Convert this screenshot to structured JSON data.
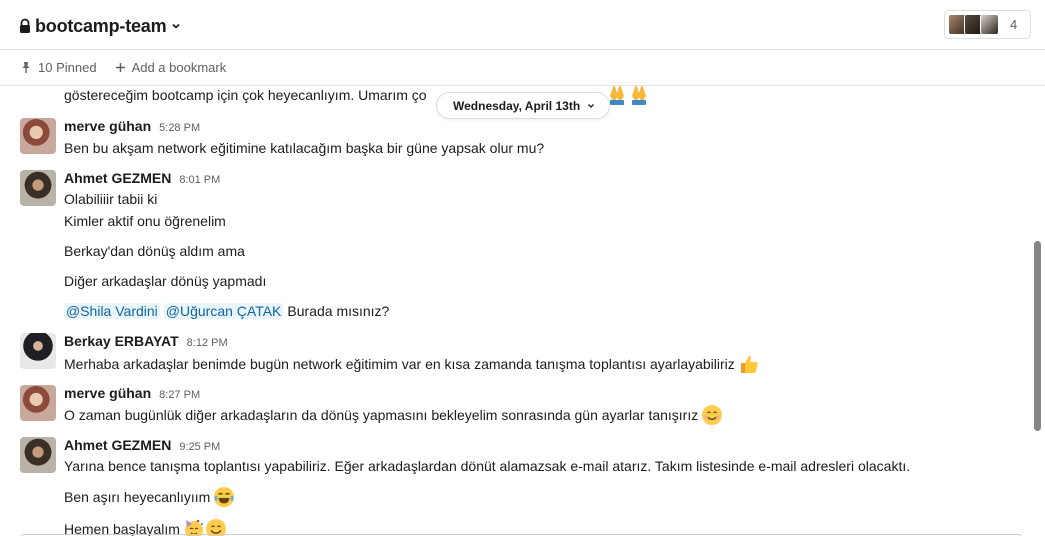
{
  "header": {
    "channel_name": "bootcamp-team",
    "member_count": "4"
  },
  "bookmarks": {
    "pinned_label": "10 Pinned",
    "add_label": "Add a bookmark"
  },
  "date_divider": "Wednesday, April 13th",
  "messages": [
    {
      "lines": [
        "göstereceğim bootcamp için çok heyecanlıyım. Umarım ço"
      ]
    },
    {
      "author": "merve gühan",
      "time": "5:28 PM",
      "lines": [
        "Ben bu akşam network eğitimine katılacağım başka bir güne yapsak olur mu?"
      ]
    },
    {
      "author": "Ahmet GEZMEN",
      "time": "8:01 PM",
      "lines": [
        "Olabiliiir tabii ki",
        "Kimler aktif onu öğrenelim",
        "Berkay'dan dönüş aldım ama",
        "Diğer arkadaşlar dönüş yapmadı"
      ],
      "mentions": [
        "@Shila Vardini",
        "@Uğurcan ÇATAK"
      ],
      "mention_tail": "Burada mısınız?"
    },
    {
      "author": "Berkay ERBAYAT",
      "time": "8:12 PM",
      "lines": [
        "Merhaba arkadaşlar benimde bugün network eğitimim var en kısa zamanda tanışma toplantısı ayarlayabiliriz"
      ]
    },
    {
      "author": "merve gühan",
      "time": "8:27 PM",
      "lines": [
        "O zaman bugünlük diğer arkadaşların da dönüş yapmasını bekleyelim sonrasında gün ayarlar tanışırız"
      ]
    },
    {
      "author": "Ahmet GEZMEN",
      "time": "9:25 PM",
      "lines": [
        "Yarına bence tanışma toplantısı yapabiliriz. Eğer arkadaşlardan dönüt alamazsak e-mail atarız. Takım listesinde e-mail adresleri olacaktı.",
        "Ben aşırı heyecanlıyıım",
        "Hemen başlayalım"
      ]
    }
  ]
}
